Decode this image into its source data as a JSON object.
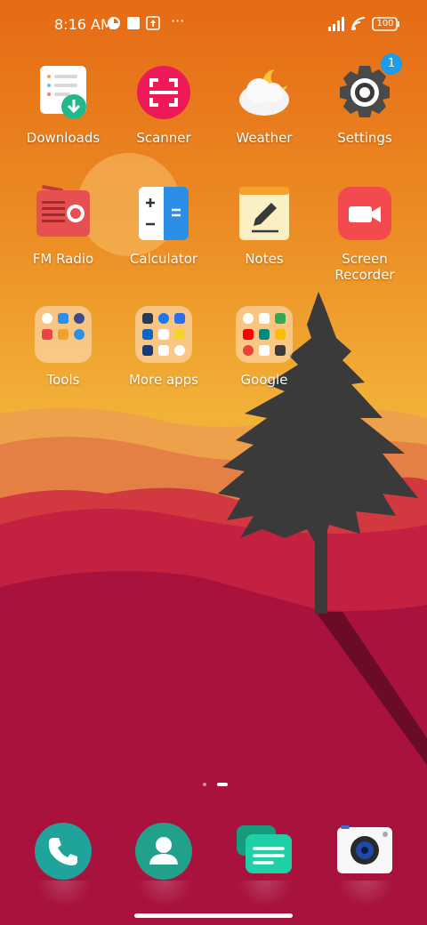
{
  "status_bar": {
    "time": "8:16 AM",
    "battery": "100",
    "more": "···"
  },
  "apps_row1": [
    {
      "label": "Downloads",
      "icon": "downloads-icon"
    },
    {
      "label": "Scanner",
      "icon": "scanner-icon"
    },
    {
      "label": "Weather",
      "icon": "weather-icon"
    },
    {
      "label": "Settings",
      "icon": "settings-icon",
      "badge": "1"
    }
  ],
  "apps_row2": [
    {
      "label": "FM Radio",
      "icon": "radio-icon"
    },
    {
      "label": "Calculator",
      "icon": "calculator-icon"
    },
    {
      "label": "Notes",
      "icon": "notes-icon"
    },
    {
      "label": "Screen\nRecorder",
      "icon": "screen-recorder-icon"
    }
  ],
  "folders": [
    {
      "label": "Tools"
    },
    {
      "label": "More apps"
    },
    {
      "label": "Google"
    }
  ],
  "page_indicator": {
    "pages": 2,
    "current": 2
  },
  "dock": [
    {
      "name": "phone",
      "icon": "phone-icon"
    },
    {
      "name": "contacts",
      "icon": "contacts-icon"
    },
    {
      "name": "messages",
      "icon": "messages-icon"
    },
    {
      "name": "camera",
      "icon": "camera-icon"
    }
  ],
  "colors": {
    "sky_top": "#e8701b",
    "sky_mid": "#f0a232",
    "hill_red": "#c8203c",
    "ground": "#a8123c",
    "tree": "#3a3a3a"
  }
}
